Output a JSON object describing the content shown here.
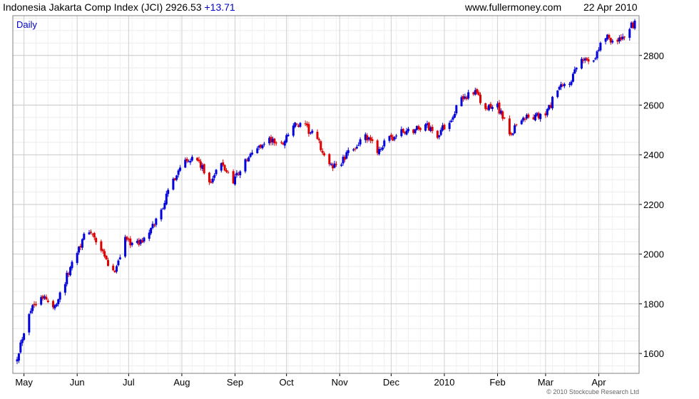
{
  "header": {
    "title": "Indonesia Jakarta Comp Index (JCI)",
    "last": "2926.53",
    "change": "+13.71",
    "site": "www.fullermoney.com",
    "date": "22 Apr 2010"
  },
  "credit": "© 2010 Stockcube Research Ltd",
  "chart_data": {
    "type": "candlestick",
    "period_label": "Daily",
    "x_range": [
      "2009-04-27",
      "2010-04-22"
    ],
    "ylim": [
      1520,
      2960
    ],
    "yticks": [
      1600,
      1800,
      2000,
      2200,
      2400,
      2600,
      2800
    ],
    "xticks": [
      {
        "label": "May",
        "date": "2009-05-01"
      },
      {
        "label": "Jun",
        "date": "2009-06-01"
      },
      {
        "label": "Jul",
        "date": "2009-07-01"
      },
      {
        "label": "Aug",
        "date": "2009-08-01"
      },
      {
        "label": "Sep",
        "date": "2009-09-01"
      },
      {
        "label": "Oct",
        "date": "2009-10-01"
      },
      {
        "label": "Nov",
        "date": "2009-11-01"
      },
      {
        "label": "Dec",
        "date": "2009-12-01"
      },
      {
        "label": "2010",
        "date": "2010-01-01"
      },
      {
        "label": "Feb",
        "date": "2010-02-01"
      },
      {
        "label": "Mar",
        "date": "2010-03-01"
      },
      {
        "label": "Apr",
        "date": "2010-04-01"
      }
    ],
    "grid": true,
    "up_color": "#0000dd",
    "down_color": "#dd0000",
    "closes": [
      [
        "2009-04-27",
        1590
      ],
      [
        "2009-05-04",
        1770
      ],
      [
        "2009-05-11",
        1840
      ],
      [
        "2009-05-18",
        1780
      ],
      [
        "2009-05-25",
        1890
      ],
      [
        "2009-06-01",
        2020
      ],
      [
        "2009-06-08",
        2100
      ],
      [
        "2009-06-15",
        2010
      ],
      [
        "2009-06-22",
        1920
      ],
      [
        "2009-06-29",
        2060
      ],
      [
        "2009-07-06",
        2040
      ],
      [
        "2009-07-13",
        2080
      ],
      [
        "2009-07-20",
        2180
      ],
      [
        "2009-07-27",
        2300
      ],
      [
        "2009-08-03",
        2390
      ],
      [
        "2009-08-10",
        2380
      ],
      [
        "2009-08-17",
        2290
      ],
      [
        "2009-08-24",
        2360
      ],
      [
        "2009-08-31",
        2300
      ],
      [
        "2009-09-07",
        2370
      ],
      [
        "2009-09-14",
        2430
      ],
      [
        "2009-09-21",
        2460
      ],
      [
        "2009-09-28",
        2440
      ],
      [
        "2009-10-05",
        2520
      ],
      [
        "2009-10-12",
        2510
      ],
      [
        "2009-10-19",
        2460
      ],
      [
        "2009-10-26",
        2350
      ],
      [
        "2009-11-02",
        2370
      ],
      [
        "2009-11-09",
        2430
      ],
      [
        "2009-11-16",
        2470
      ],
      [
        "2009-11-23",
        2420
      ],
      [
        "2009-11-30",
        2460
      ],
      [
        "2009-12-07",
        2490
      ],
      [
        "2009-12-14",
        2500
      ],
      [
        "2009-12-21",
        2520
      ],
      [
        "2009-12-28",
        2480
      ],
      [
        "2010-01-04",
        2540
      ],
      [
        "2010-01-11",
        2620
      ],
      [
        "2010-01-18",
        2660
      ],
      [
        "2010-01-25",
        2580
      ],
      [
        "2010-02-01",
        2600
      ],
      [
        "2010-02-08",
        2480
      ],
      [
        "2010-02-15",
        2550
      ],
      [
        "2010-02-22",
        2550
      ],
      [
        "2010-03-01",
        2560
      ],
      [
        "2010-03-08",
        2660
      ],
      [
        "2010-03-15",
        2690
      ],
      [
        "2010-03-22",
        2780
      ],
      [
        "2010-03-29",
        2790
      ],
      [
        "2010-04-05",
        2880
      ],
      [
        "2010-04-12",
        2850
      ],
      [
        "2010-04-19",
        2910
      ],
      [
        "2010-04-22",
        2926
      ]
    ]
  }
}
